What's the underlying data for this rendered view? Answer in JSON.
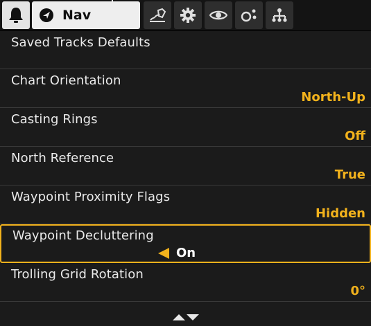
{
  "tabs": {
    "alarm": {
      "icon": "bell-icon"
    },
    "nav": {
      "icon": "navigation-arrow-icon",
      "label": "Nav"
    },
    "chart": {
      "icon": "chart-icon"
    },
    "settings": {
      "icon": "gear-icon"
    },
    "views": {
      "icon": "eye-icon"
    },
    "network": {
      "icon": "network-icon"
    },
    "accessories": {
      "icon": "tree-icon"
    }
  },
  "menu": {
    "items": [
      {
        "title": "Saved Tracks Defaults",
        "value": ""
      },
      {
        "title": "Chart Orientation",
        "value": "North-Up"
      },
      {
        "title": "Casting Rings",
        "value": "Off"
      },
      {
        "title": "North Reference",
        "value": "True"
      },
      {
        "title": "Waypoint Proximity Flags",
        "value": "Hidden"
      },
      {
        "title": "Waypoint Decluttering",
        "value": "On",
        "selected": true
      },
      {
        "title": "Trolling Grid Rotation",
        "value": "0°"
      }
    ]
  },
  "scroll": {
    "icon": "scroll-arrows-icon"
  },
  "colors": {
    "accent": "#f2b21c",
    "background": "#1b1b1b",
    "text": "#eaeaea"
  }
}
